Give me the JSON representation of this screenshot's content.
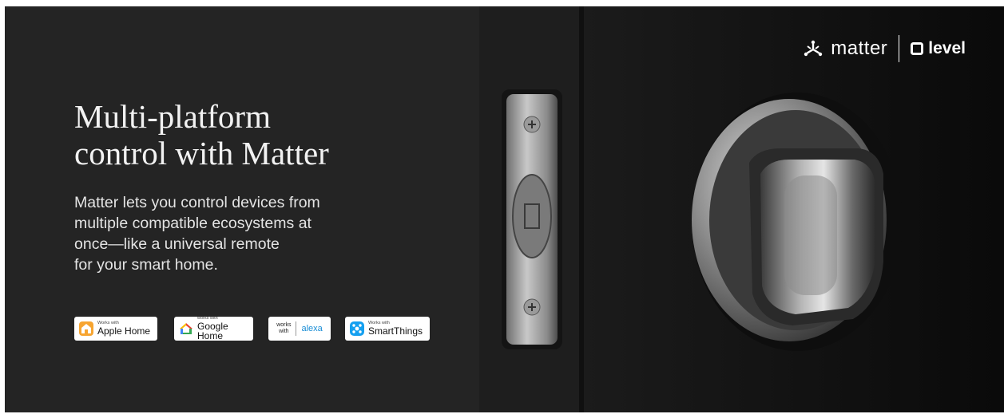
{
  "hero": {
    "title_line1": "Multi-platform",
    "title_line2": "control with Matter",
    "body_lines": [
      "Matter lets you control devices from",
      "multiple compatible ecosystems at",
      "once—like a universal remote",
      "for your smart home."
    ]
  },
  "badges": {
    "apple": {
      "small": "Works with",
      "big": "Apple Home"
    },
    "google": {
      "small": "works with",
      "big": "Google Home"
    },
    "alexa": {
      "works_line1": "works",
      "works_line2": "with",
      "brand": "alexa"
    },
    "smartthings": {
      "small": "Works with",
      "big": "SmartThings"
    }
  },
  "brand": {
    "matter": "matter",
    "level": "level"
  },
  "colors": {
    "panel_bg": "#242424",
    "alexa_blue": "#1a8ed6",
    "apple_orange": "#f7a531",
    "smartthings_blue": "#15a0f0"
  },
  "icons": [
    "matter-icon",
    "level-icon",
    "apple-home-icon",
    "google-home-icon",
    "smartthings-icon"
  ]
}
